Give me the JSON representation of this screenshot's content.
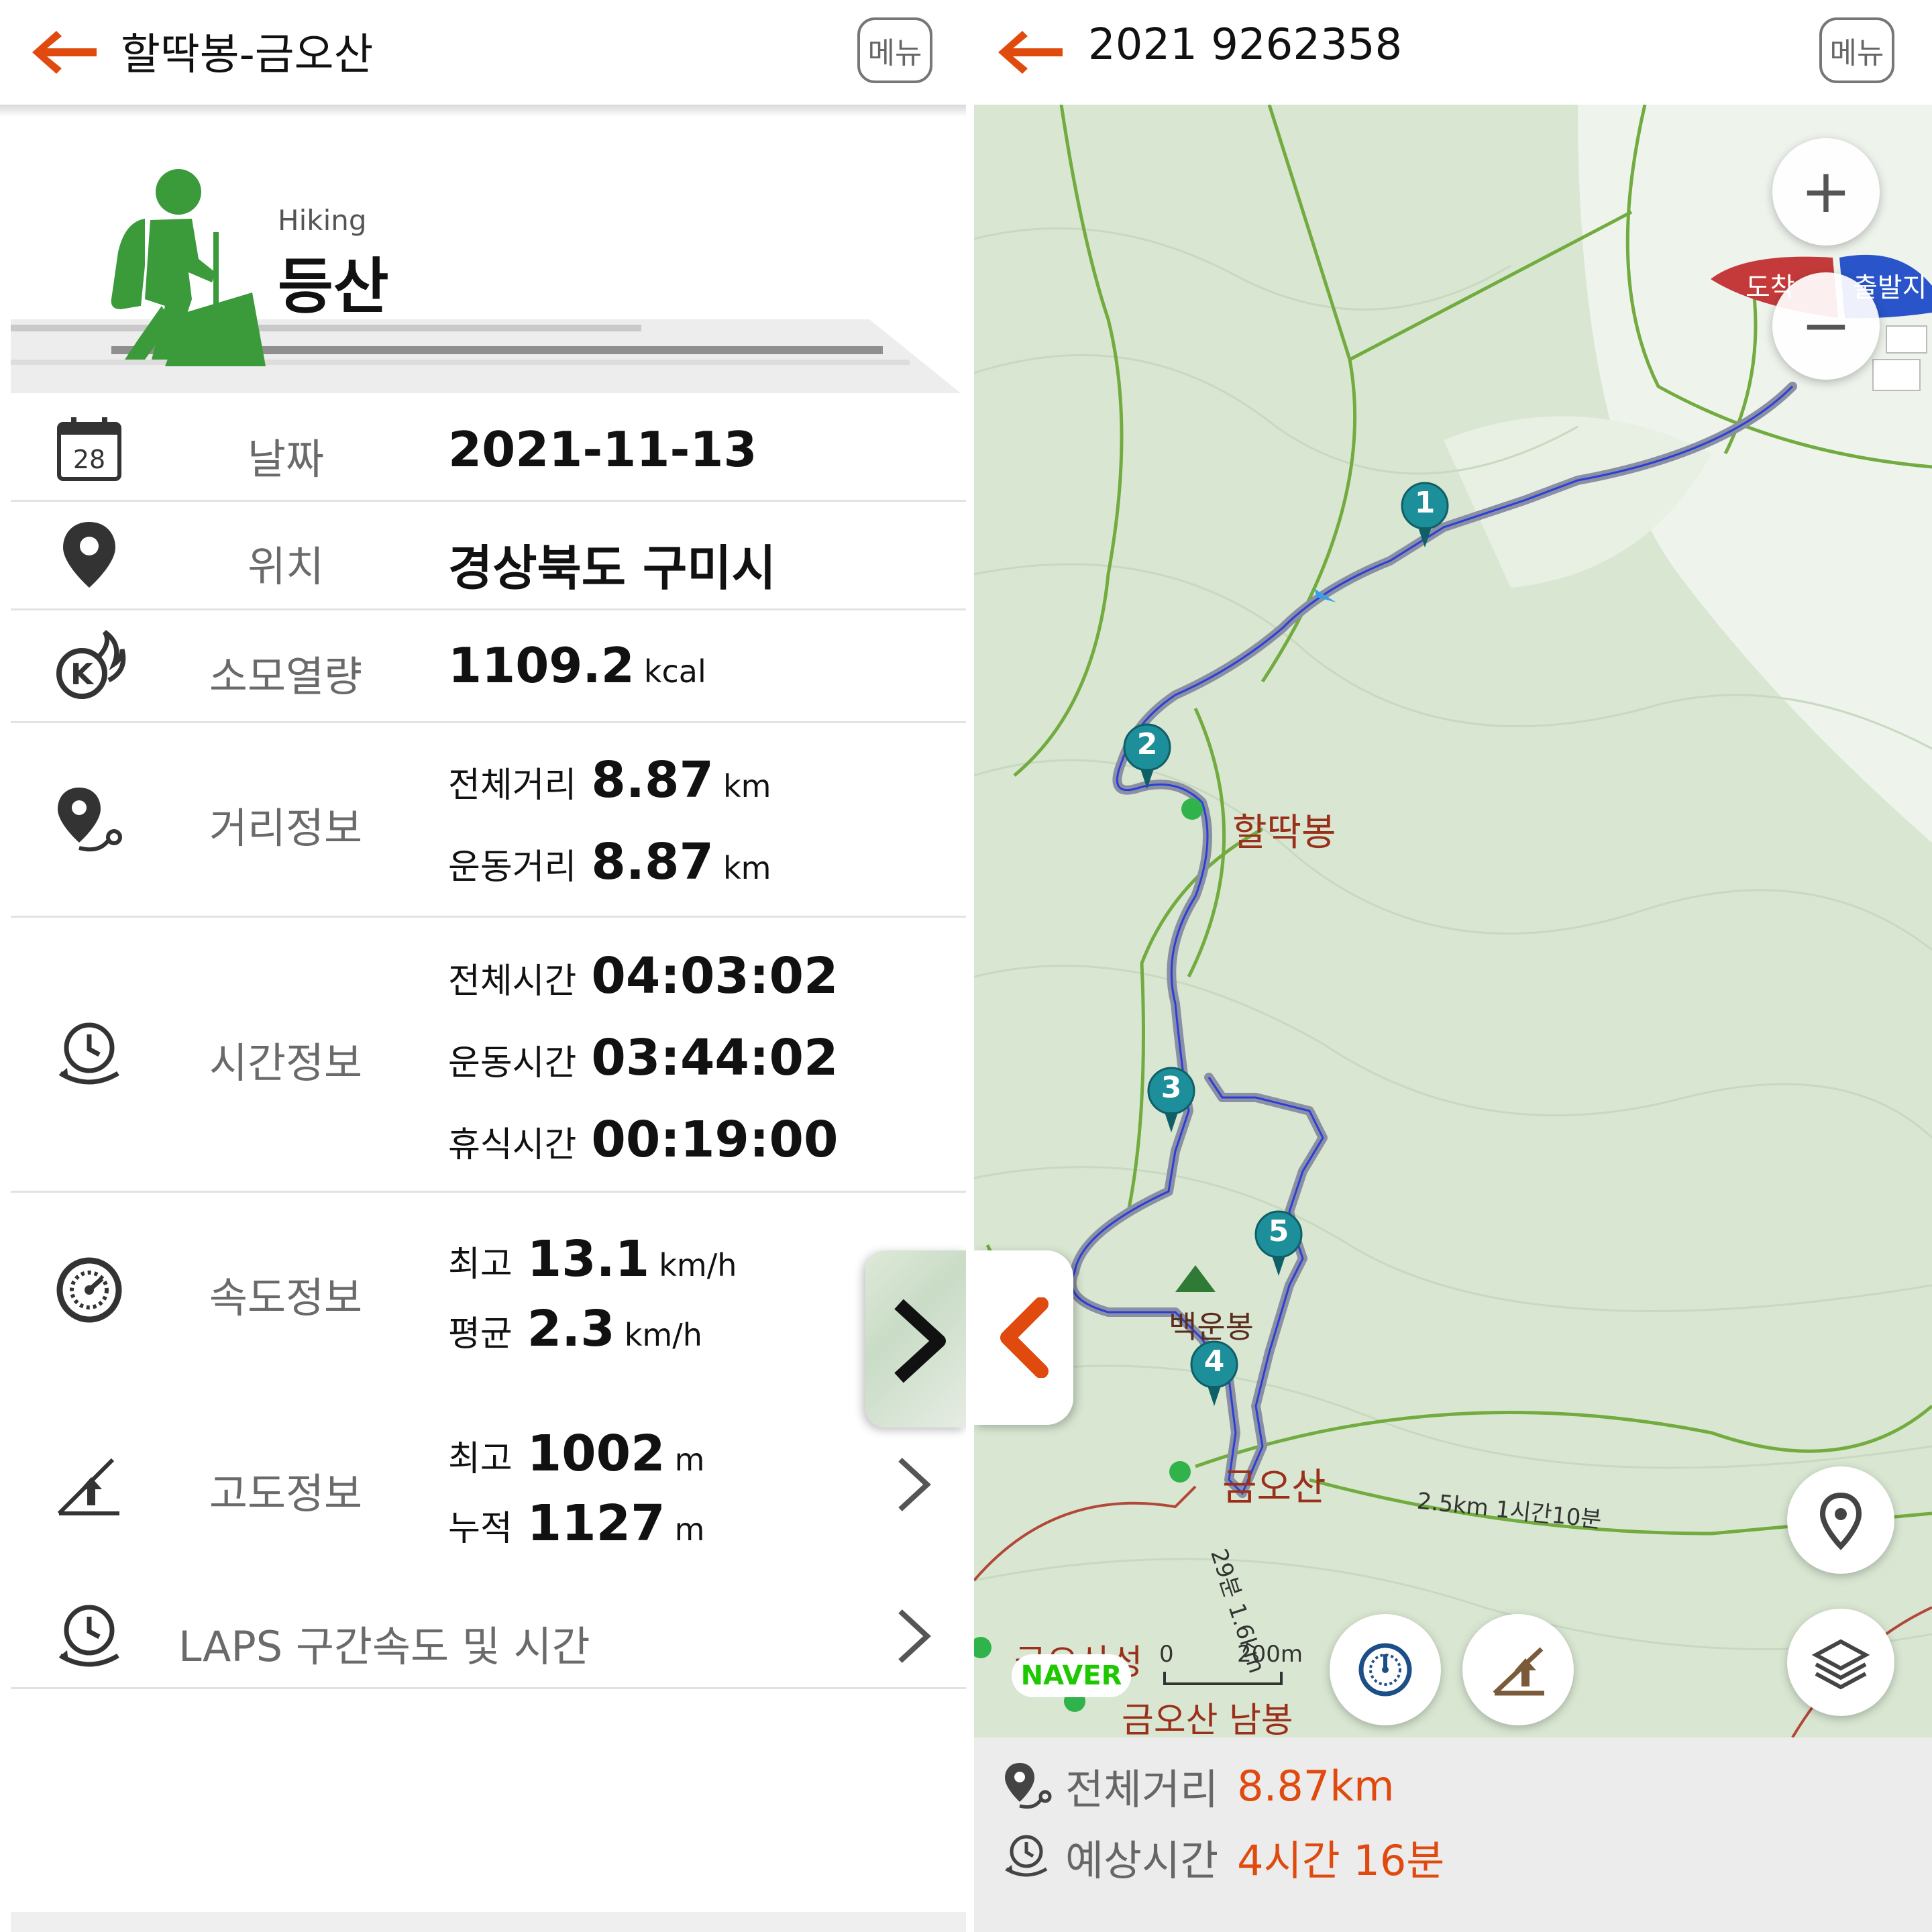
{
  "left": {
    "header": {
      "title": "할딱봉-금오산",
      "menu_label": "메뉴"
    },
    "activity": {
      "name_en": "Hiking",
      "name_ko": "등산"
    },
    "rows": {
      "date": {
        "icon_text": "28",
        "label": "날짜",
        "value": "2021-11-13"
      },
      "location": {
        "label": "위치",
        "value": "경상북도 구미시"
      },
      "calories": {
        "label": "소모열량",
        "value": "1109.2",
        "unit": "kcal"
      },
      "distance": {
        "label": "거리정보",
        "total_label": "전체거리",
        "total_value": "8.87",
        "total_unit": "km",
        "moving_label": "운동거리",
        "moving_value": "8.87",
        "moving_unit": "km"
      },
      "time": {
        "label": "시간정보",
        "total_label": "전체시간",
        "total_value": "04:03:02",
        "moving_label": "운동시간",
        "moving_value": "03:44:02",
        "rest_label": "휴식시간",
        "rest_value": "00:19:00"
      },
      "speed": {
        "label": "속도정보",
        "max_label": "최고",
        "max_value": "13.1",
        "max_unit": "km/h",
        "avg_label": "평균",
        "avg_value": "2.3",
        "avg_unit": "km/h"
      },
      "altitude": {
        "label": "고도정보",
        "max_label": "최고",
        "max_value": "1002",
        "max_unit": "m",
        "cum_label": "누적",
        "cum_value": "1127",
        "cum_unit": "m"
      },
      "laps": {
        "label": "LAPS 구간속도 및 시간"
      }
    }
  },
  "right": {
    "header": {
      "title": "2021 9262358",
      "menu_label": "메뉴"
    },
    "map": {
      "zoom_in": "+",
      "zoom_out": "−",
      "flag_left": "도착",
      "flag_right": "출발지",
      "peaks": [
        "할딱봉",
        "백운봉",
        "금오산",
        "금오산성",
        "금오산 남봉"
      ],
      "trail_note": "2.5km 1시간10분",
      "trail_note_2": "29분 1.6km",
      "markers": [
        "1",
        "2",
        "3",
        "4",
        "5"
      ],
      "scale_zero": "0",
      "scale_value": "200m",
      "brand": "NAVER"
    },
    "footer": {
      "distance_label": "전체거리",
      "distance_value": "8.87km",
      "eta_label": "예상시간",
      "eta_value": "4시간 16분"
    }
  },
  "colors": {
    "accent": "#e04a0e",
    "hiker_green": "#3b9a3a",
    "route": "#8a8fa3",
    "marker": "#1d8f9a"
  }
}
